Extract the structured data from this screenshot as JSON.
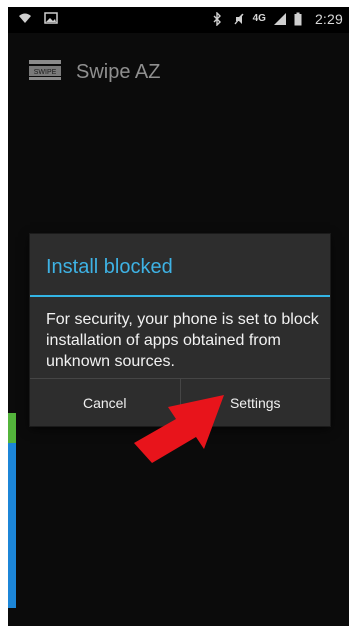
{
  "status_bar": {
    "time": "2:29",
    "network": "4G",
    "icons": [
      "wifi-icon",
      "image-icon",
      "bluetooth-icon",
      "mute-icon",
      "signal-icon",
      "battery-icon"
    ]
  },
  "action_bar": {
    "title": "Swipe AZ",
    "logo_text": "SWIPE"
  },
  "dialog": {
    "title": "Install blocked",
    "message": "For security, your phone is set to block installation of apps obtained from unknown sources.",
    "cancel_label": "Cancel",
    "settings_label": "Settings"
  },
  "colors": {
    "accent": "#33b5e5",
    "dialog_bg": "#2d2d2d",
    "screen_bg": "#0b0b0b",
    "annotation_arrow": "#e8141b"
  }
}
